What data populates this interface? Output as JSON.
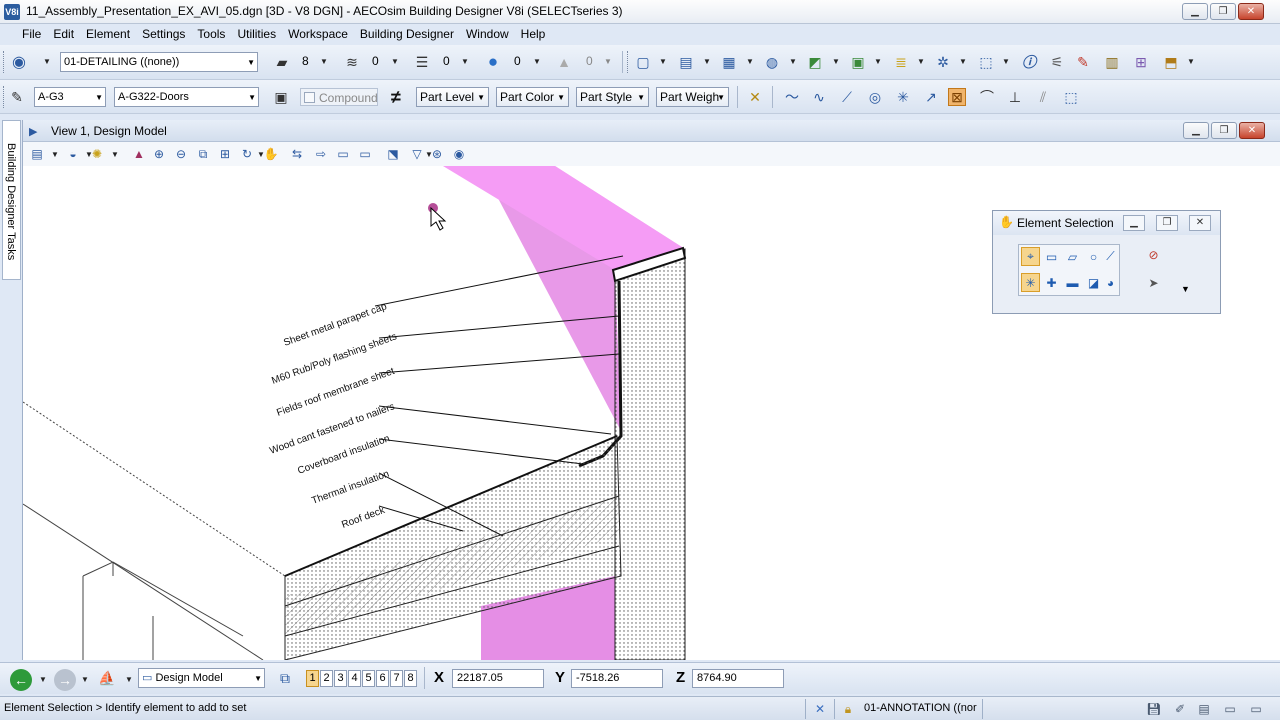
{
  "window": {
    "title": "11_Assembly_Presentation_EX_AVI_05.dgn [3D - V8 DGN] - AECOsim Building Designer V8i (SELECTseries 3)",
    "app_icon_text": "V8i"
  },
  "menu": [
    "File",
    "Edit",
    "Element",
    "Settings",
    "Tools",
    "Utilities",
    "Workspace",
    "Building Designer",
    "Window",
    "Help"
  ],
  "toolbar1": {
    "level_combo": "01-DETAILING ((none))",
    "color_value": "8",
    "style_value": "0",
    "weight_value": "0",
    "transparency_value": "0",
    "priority_value": "0"
  },
  "toolbar2": {
    "family_combo": "A-G3",
    "part_combo": "A-G322-Doors",
    "compound_label": "Compound",
    "part_level": "Part Level",
    "part_color": "Part Color",
    "part_style": "Part Style",
    "part_weight": "Part Weigh"
  },
  "sidetab": {
    "label": "Building Designer Tasks"
  },
  "view": {
    "title": "View 1, Design Model"
  },
  "annotations": [
    "Sheet metal parapet cap",
    "M60 Rub/Poly flashing sheets",
    "Fields roof membrane sheet",
    "Wood cant fastened to nailers",
    "Coverboard insulation",
    "Thermal insulation",
    "Roof deck"
  ],
  "element_selection": {
    "title": "Element Selection"
  },
  "bottombar": {
    "model_combo": "Design Model",
    "view_numbers": [
      "1",
      "2",
      "3",
      "4",
      "5",
      "6",
      "7",
      "8"
    ],
    "x_label": "X",
    "x_value": "22187.05",
    "y_label": "Y",
    "y_value": "-7518.26",
    "z_label": "Z",
    "z_value": "8764.90"
  },
  "status": {
    "message": "Element Selection > Identify element to add to set",
    "active_level": "01-ANNOTATION ((nor"
  },
  "colors": {
    "accent_blue": "#2c5aa0",
    "highlight_magenta": "#e58ee5",
    "active_button": "#f6d58e"
  }
}
